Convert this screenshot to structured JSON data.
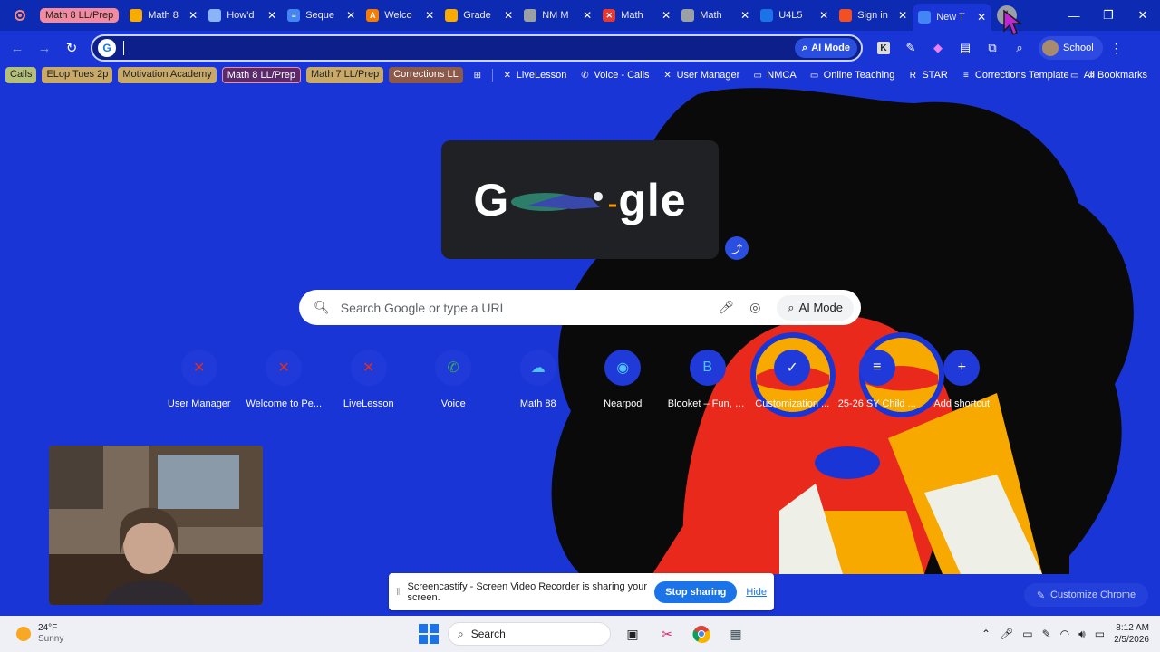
{
  "tabs": {
    "group_label": "Math 8 LL/Prep",
    "items": [
      {
        "title": "Math 8",
        "fav_color": "#f9ab00",
        "fav_glyph": ""
      },
      {
        "title": "How'd",
        "fav_color": "#8ab4f8",
        "fav_glyph": ""
      },
      {
        "title": "Seque",
        "fav_color": "#4285f4",
        "fav_glyph": "≡"
      },
      {
        "title": "Welco",
        "fav_color": "#f57c00",
        "fav_glyph": "A"
      },
      {
        "title": "Grade",
        "fav_color": "#f9ab00",
        "fav_glyph": ""
      },
      {
        "title": "NM M",
        "fav_color": "#9aa0a6",
        "fav_glyph": ""
      },
      {
        "title": "Math",
        "fav_color": "#e53935",
        "fav_glyph": "✕"
      },
      {
        "title": "Math",
        "fav_color": "#9aa0a6",
        "fav_glyph": ""
      },
      {
        "title": "U4L5",
        "fav_color": "#1a73e8",
        "fav_glyph": ""
      },
      {
        "title": "Sign in",
        "fav_color": "#f25022",
        "fav_glyph": ""
      },
      {
        "title": "New T",
        "fav_color": "#4285f4",
        "fav_glyph": ""
      }
    ],
    "new_tab_label": "+"
  },
  "window": {
    "minimize": "—",
    "restore": "❐",
    "close": "✕"
  },
  "toolbar": {
    "back": "←",
    "forward": "→",
    "reload": "↻",
    "ai_mode": "AI Mode",
    "profile": "School"
  },
  "bookmarks": {
    "chips": [
      {
        "label": "Calls",
        "style": "green"
      },
      {
        "label": "ELop Tues 2p",
        "style": "tan"
      },
      {
        "label": "Motivation Academy",
        "style": "tan"
      },
      {
        "label": "Math 8 LL/Prep",
        "style": "outline"
      },
      {
        "label": "Math 7 LL/Prep",
        "style": "tan"
      },
      {
        "label": "Corrections LL",
        "style": "brown"
      }
    ],
    "links": [
      {
        "label": "LiveLesson",
        "icon": "✕"
      },
      {
        "label": "Voice - Calls",
        "icon": "✆"
      },
      {
        "label": "User Manager",
        "icon": "✕"
      },
      {
        "label": "NMCA",
        "icon": "▭"
      },
      {
        "label": "Online Teaching",
        "icon": "▭"
      },
      {
        "label": "STAR",
        "icon": "R"
      },
      {
        "label": "Corrections Template",
        "icon": "≡"
      }
    ],
    "more": "»",
    "all_bookmarks": "All Bookmarks"
  },
  "ntp": {
    "logo_left": "G",
    "logo_right": "gle",
    "search_placeholder": "Search Google or type a URL",
    "ai_mode": "AI Mode",
    "shortcuts": [
      {
        "label": "User Manager",
        "glyph": "✕",
        "color": "#d93025"
      },
      {
        "label": "Welcome to Pe...",
        "glyph": "✕",
        "color": "#d93025"
      },
      {
        "label": "LiveLesson",
        "glyph": "✕",
        "color": "#d93025"
      },
      {
        "label": "Voice",
        "glyph": "✆",
        "color": "#34a853"
      },
      {
        "label": "Math 88",
        "glyph": "☁",
        "color": "#4fc3f7"
      },
      {
        "label": "Nearpod",
        "glyph": "◉",
        "color": "#4fc3f7"
      },
      {
        "label": "Blooket – Fun, F...",
        "glyph": "B",
        "color": "#4fc3f7"
      },
      {
        "label": "Customization ...",
        "glyph": "✓",
        "color": "#ffffff"
      },
      {
        "label": "25-26 SY Child ...",
        "glyph": "≡",
        "color": "#ffffff"
      },
      {
        "label": "Add shortcut",
        "glyph": "+",
        "color": "#ffffff"
      }
    ],
    "customize": "Customize Chrome"
  },
  "share_bar": {
    "message": "Screencastify - Screen Video Recorder is sharing your screen.",
    "stop": "Stop sharing",
    "hide": "Hide"
  },
  "taskbar": {
    "temp": "24°F",
    "condition": "Sunny",
    "search": "Search",
    "time": "8:12 AM",
    "date": "2/5/2026"
  }
}
